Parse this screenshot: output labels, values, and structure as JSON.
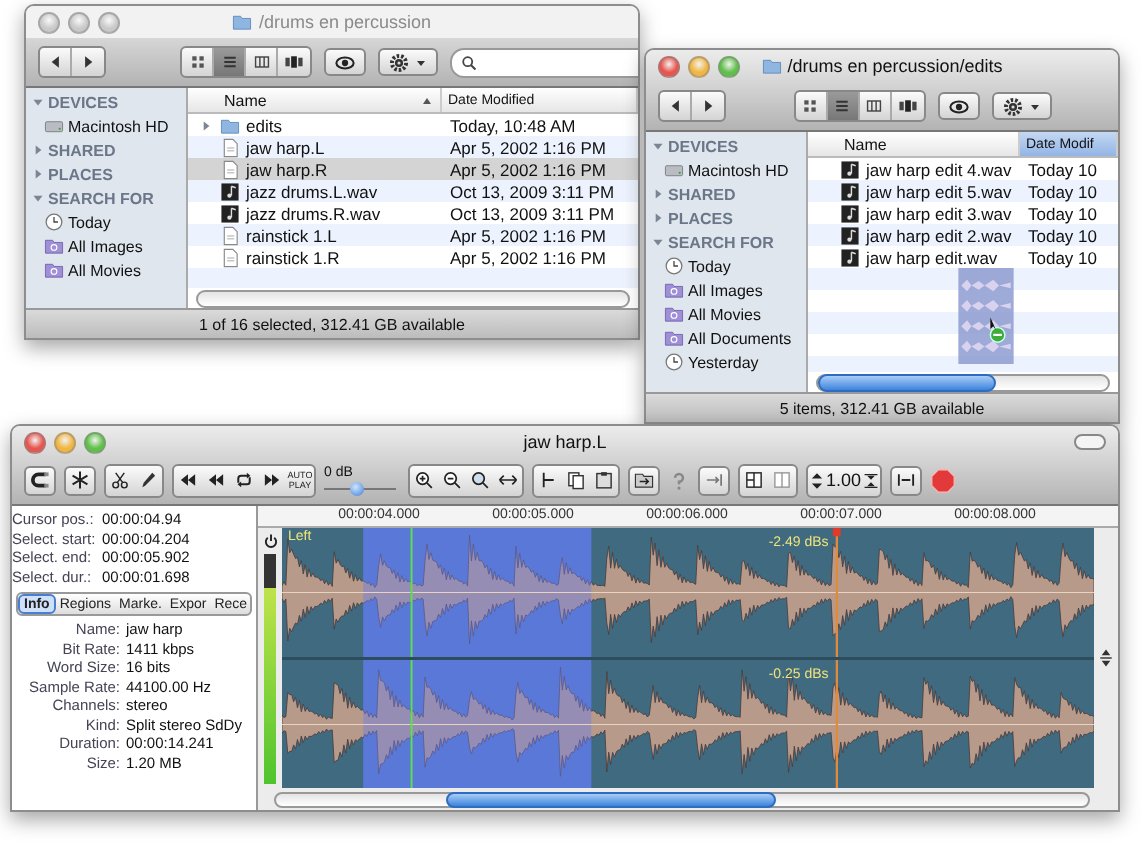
{
  "finder_windows": [
    {
      "title": "/drums en percussion",
      "active": false,
      "has_search": true,
      "dragging": false,
      "views": [
        {
          "kind": "icons",
          "selected": false
        },
        {
          "kind": "list",
          "selected": true
        },
        {
          "kind": "columns",
          "selected": false
        },
        {
          "kind": "coverflow",
          "selected": false
        }
      ],
      "sidebar": [
        {
          "kind": "header",
          "label": "DEVICES",
          "expanded": true
        },
        {
          "kind": "disk",
          "label": "Macintosh HD"
        },
        {
          "kind": "header",
          "label": "SHARED",
          "expanded": false
        },
        {
          "kind": "header",
          "label": "PLACES",
          "expanded": false
        },
        {
          "kind": "header",
          "label": "SEARCH FOR",
          "expanded": true
        },
        {
          "kind": "clock",
          "label": "Today"
        },
        {
          "kind": "smartfolder",
          "label": "All Images"
        },
        {
          "kind": "smartfolder",
          "label": "All Movies"
        }
      ],
      "columns": [
        {
          "label": "Name",
          "sorted": true
        },
        {
          "label": "Date Modified",
          "sorted": false
        }
      ],
      "rows": [
        {
          "kind": "folder",
          "name": "edits",
          "date": "Today, 10:48 AM",
          "selected": false
        },
        {
          "kind": "document",
          "name": "jaw harp.L",
          "date": "Apr 5, 2002 1:16 PM",
          "selected": false
        },
        {
          "kind": "document",
          "name": "jaw harp.R",
          "date": "Apr 5, 2002 1:16 PM",
          "selected": true
        },
        {
          "kind": "audio",
          "name": "jazz drums.L.wav",
          "date": "Oct 13, 2009 3:11 PM",
          "selected": false
        },
        {
          "kind": "audio",
          "name": "jazz drums.R.wav",
          "date": "Oct 13, 2009 3:11 PM",
          "selected": false
        },
        {
          "kind": "document",
          "name": "rainstick 1.L",
          "date": "Apr 5, 2002 1:16 PM",
          "selected": false
        },
        {
          "kind": "document",
          "name": "rainstick 1.R",
          "date": "Apr 5, 2002 1:16 PM",
          "selected": false
        }
      ],
      "status": "1 of 16 selected, 312.41 GB available"
    },
    {
      "title": "/drums en percussion/edits",
      "active": true,
      "has_search": false,
      "dragging": true,
      "views": [
        {
          "kind": "icons",
          "selected": false
        },
        {
          "kind": "list",
          "selected": true
        },
        {
          "kind": "columns",
          "selected": false
        },
        {
          "kind": "coverflow",
          "selected": false
        }
      ],
      "sidebar": [
        {
          "kind": "header",
          "label": "DEVICES",
          "expanded": true
        },
        {
          "kind": "disk",
          "label": "Macintosh HD"
        },
        {
          "kind": "header",
          "label": "SHARED",
          "expanded": false
        },
        {
          "kind": "header",
          "label": "PLACES",
          "expanded": false
        },
        {
          "kind": "header",
          "label": "SEARCH FOR",
          "expanded": true
        },
        {
          "kind": "clock",
          "label": "Today"
        },
        {
          "kind": "smartfolder",
          "label": "All Images"
        },
        {
          "kind": "smartfolder",
          "label": "All Movies"
        },
        {
          "kind": "smartfolder",
          "label": "All Documents"
        },
        {
          "kind": "clock",
          "label": "Yesterday"
        }
      ],
      "columns": [
        {
          "label": "Name",
          "sorted": false
        },
        {
          "label": "Date Modif",
          "sorted": true
        }
      ],
      "rows": [
        {
          "kind": "audio",
          "name": "jaw harp edit 4.wav",
          "date": "Today 10",
          "selected": false
        },
        {
          "kind": "audio",
          "name": "jaw harp edit 5.wav",
          "date": "Today 10",
          "selected": false
        },
        {
          "kind": "audio",
          "name": "jaw harp edit 3.wav",
          "date": "Today 10",
          "selected": false
        },
        {
          "kind": "audio",
          "name": "jaw harp edit 2.wav",
          "date": "Today 10",
          "selected": false
        },
        {
          "kind": "audio",
          "name": "jaw harp edit.wav",
          "date": "Today 10",
          "selected": false
        }
      ],
      "status": "5 items, 312.41 GB available"
    }
  ],
  "editor": {
    "title": "jaw harp.L",
    "active": true,
    "toolbar": {
      "autoplay": "AUTO PLAY",
      "gain_label": "0 dB",
      "gain": {
        "level": 0.45
      },
      "zoom_factor": "1.00"
    },
    "readouts": [
      {
        "label": "Cursor pos.:",
        "value": "00:00:04.94"
      },
      {
        "label": "Select. start:",
        "value": "00:00:04.204"
      },
      {
        "label": "Select. end:",
        "value": "00:00:05.902"
      },
      {
        "label": "Select. dur.:",
        "value": "00:00:01.698"
      }
    ],
    "tabs": [
      {
        "label": "Info",
        "selected": true
      },
      {
        "label": "Regions",
        "selected": false
      },
      {
        "label": "Marke.",
        "selected": false
      },
      {
        "label": "Expor",
        "selected": false
      },
      {
        "label": "Rece",
        "selected": false
      }
    ],
    "info": [
      {
        "label": "Name:",
        "value": "jaw harp"
      },
      {
        "label": "Bit Rate:",
        "value": "1411 kbps"
      },
      {
        "label": "Word Size:",
        "value": "16 bits"
      },
      {
        "label": "Sample Rate:",
        "value": "44100.00 Hz"
      },
      {
        "label": "Channels:",
        "value": "stereo"
      },
      {
        "label": "Kind:",
        "value": "Split stereo SdDy"
      },
      {
        "label": "Duration:",
        "value": "00:00:14.241"
      },
      {
        "label": "Size:",
        "value": "1.20 MB"
      }
    ],
    "ruler": [
      "00:00:04.000",
      "00:00:05.000",
      "00:00:06.000",
      "00:00:07.000",
      "00:00:08.000"
    ],
    "meter": {
      "level": 0.85
    },
    "channels": [
      {
        "label": "Left",
        "peak": "-2.49 dBs"
      },
      {
        "peak": "-0.25 dBs"
      }
    ]
  }
}
